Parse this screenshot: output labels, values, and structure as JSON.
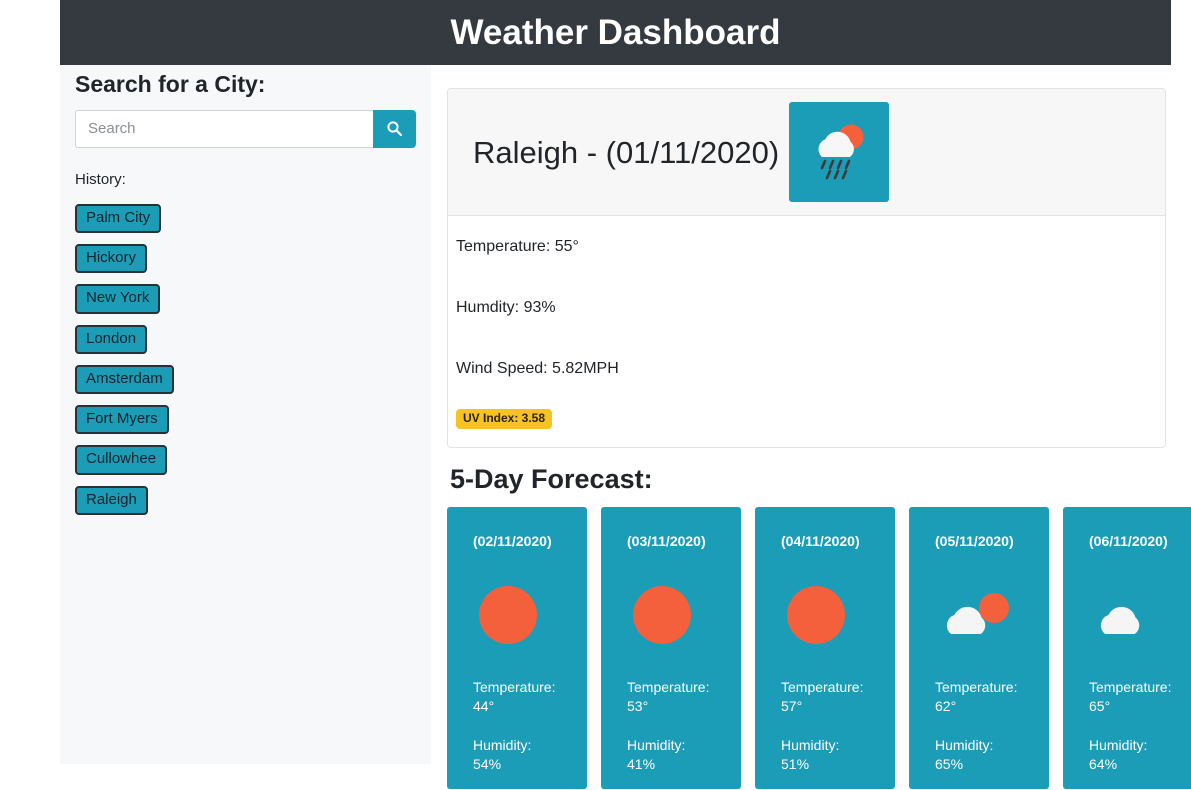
{
  "header": {
    "title": "Weather Dashboard",
    "background_color": "#343a40"
  },
  "sidebar": {
    "heading": "Search for a City:",
    "search": {
      "placeholder": "Search",
      "value": "",
      "button_icon": "search-icon"
    },
    "history_label": "History:",
    "history": [
      {
        "label": "Palm City"
      },
      {
        "label": "Hickory"
      },
      {
        "label": "New York"
      },
      {
        "label": "London"
      },
      {
        "label": "Amsterdam"
      },
      {
        "label": "Fort Myers"
      },
      {
        "label": "Cullowhee"
      },
      {
        "label": "Raleigh"
      }
    ]
  },
  "current": {
    "city_and_date": "Raleigh - (01/11/2020)",
    "icon": "rain-with-sun-icon",
    "temperature": "Temperature: 55°",
    "humidity": "Humdity: 93%",
    "wind_speed": "Wind Speed: 5.82MPH",
    "uv_index": "UV Index: 3.58"
  },
  "forecast": {
    "heading": "5-Day Forecast:",
    "days": [
      {
        "date": "(02/11/2020)",
        "icon": "sun-icon",
        "temperature_label": "Temperature:",
        "temperature_value": "44°",
        "humidity_label": "Humidity:",
        "humidity_value": "54%"
      },
      {
        "date": "(03/11/2020)",
        "icon": "sun-icon",
        "temperature_label": "Temperature:",
        "temperature_value": "53°",
        "humidity_label": "Humidity:",
        "humidity_value": "41%"
      },
      {
        "date": "(04/11/2020)",
        "icon": "sun-icon",
        "temperature_label": "Temperature:",
        "temperature_value": "57°",
        "humidity_label": "Humidity:",
        "humidity_value": "51%"
      },
      {
        "date": "(05/11/2020)",
        "icon": "partly-cloudy-icon",
        "temperature_label": "Temperature:",
        "temperature_value": "62°",
        "humidity_label": "Humidity:",
        "humidity_value": "65%"
      },
      {
        "date": "(06/11/2020)",
        "icon": "cloud-icon",
        "temperature_label": "Temperature:",
        "temperature_value": "65°",
        "humidity_label": "Humidity:",
        "humidity_value": "64%"
      }
    ]
  },
  "colors": {
    "teal": "#1b9cb7",
    "header_dark": "#343a40",
    "sun_orange": "#f4603c",
    "uv_badge": "#f6c324",
    "sidebar_bg": "#f7f8f9"
  }
}
